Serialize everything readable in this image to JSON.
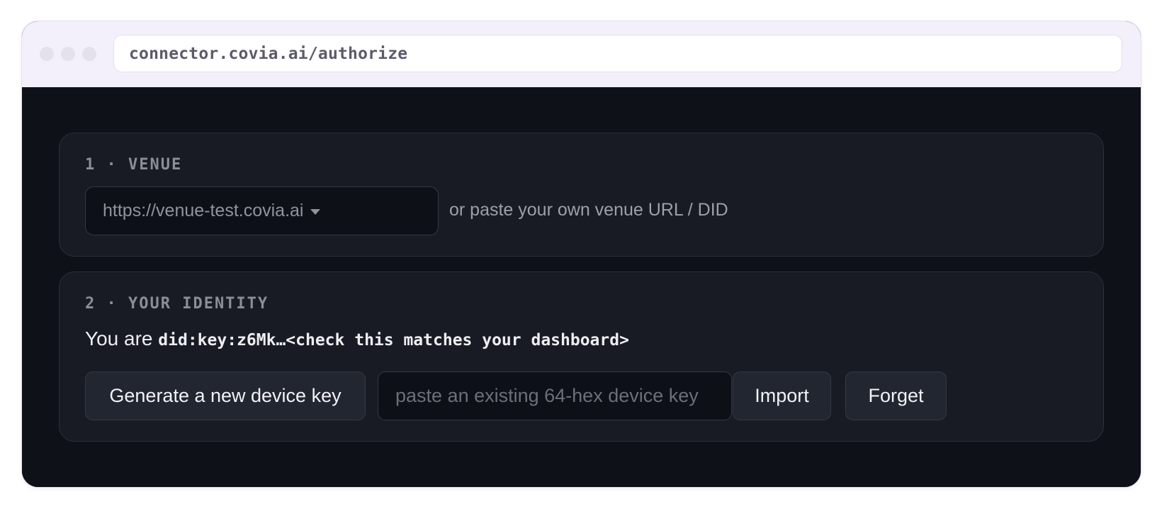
{
  "browser": {
    "url": "connector.covia.ai/authorize"
  },
  "venue": {
    "title": "1 · VENUE",
    "selected": "https://venue-test.covia.ai",
    "hint": "or paste your own venue URL / DID"
  },
  "identity": {
    "title": "2 · YOUR IDENTITY",
    "prefix": "You are ",
    "did": "did:key:z6Mk…<check this matches your dashboard>",
    "generate_label": "Generate a new device key",
    "key_placeholder": "paste an existing 64-hex device key",
    "key_value": "",
    "import_label": "Import",
    "forget_label": "Forget"
  },
  "colors": {
    "page_bg": "#0e1118",
    "card_bg": "#181b23",
    "titlebar_bg": "#f3f0fb"
  }
}
